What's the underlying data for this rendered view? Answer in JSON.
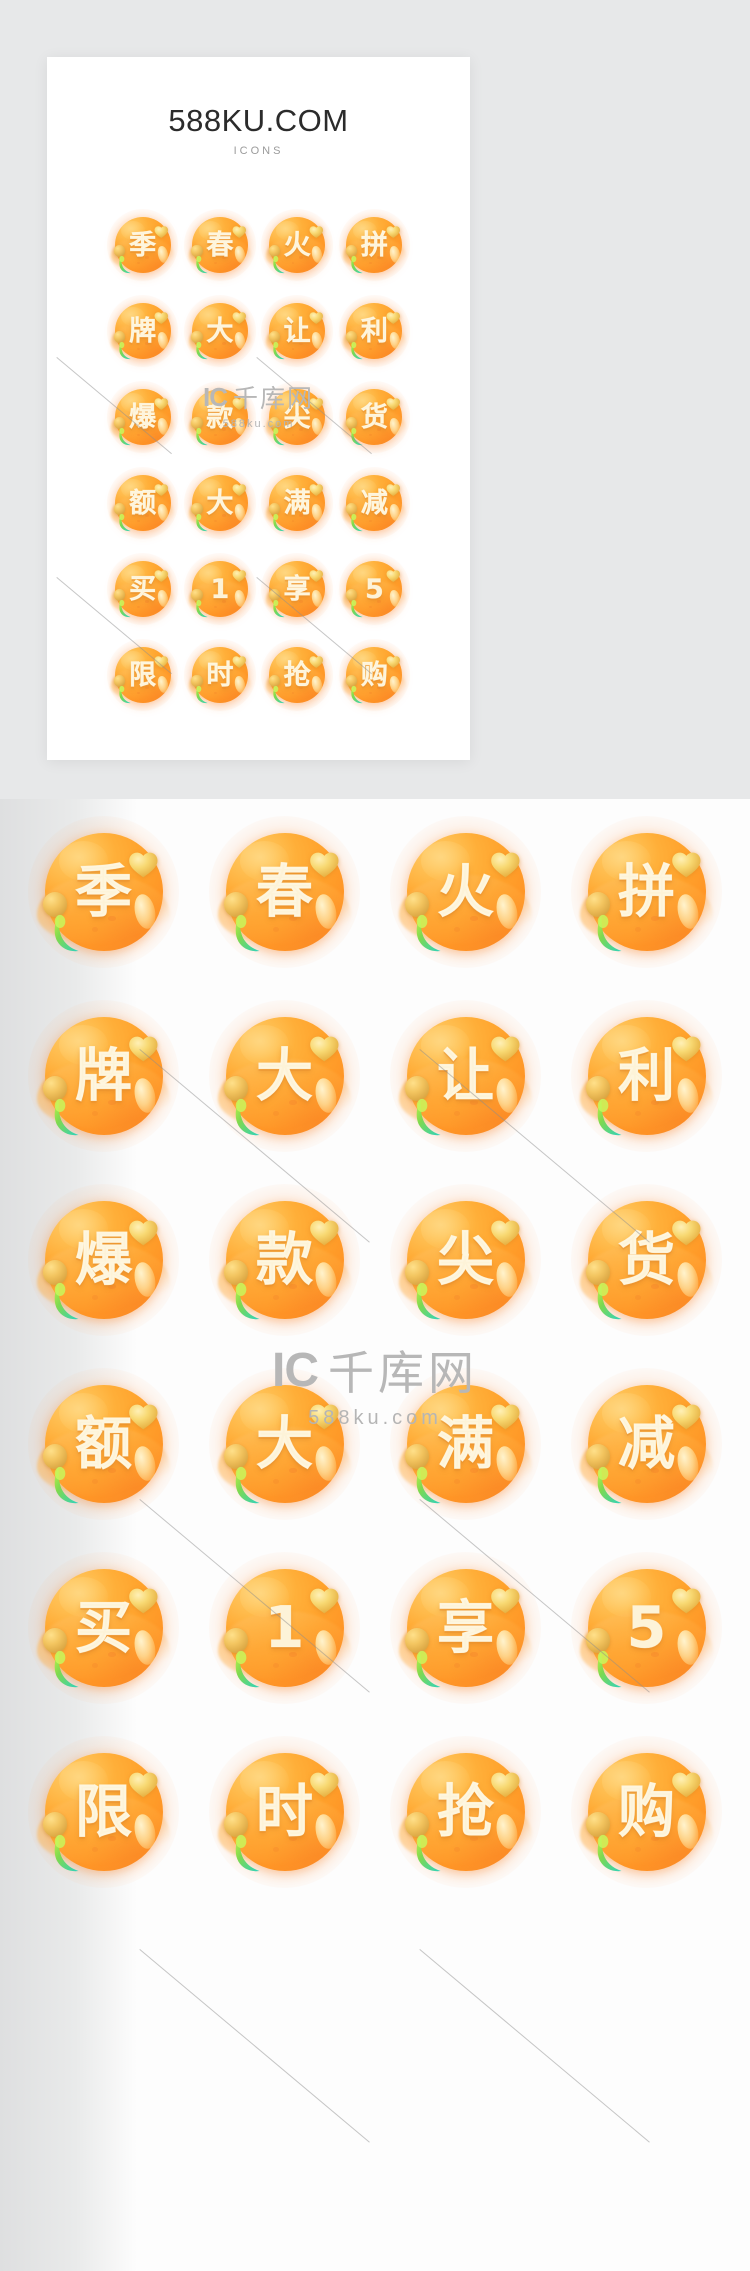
{
  "background_color": "#e7e8e9",
  "preview": {
    "title": "588KU.COM",
    "subtitle": "ICONS"
  },
  "watermark": {
    "logo_mark": "IC",
    "brand_cn": "千库网",
    "url": "588ku.com"
  },
  "colors": {
    "icon_gradient_start": "#ffc04e",
    "icon_gradient_end": "#f98b23",
    "icon_label": "#fdf3d8",
    "heart": "#f6cf63",
    "pebble": "#e0ae47",
    "leaf_green": "#8fd14a",
    "leaf_teal": "#3fd0c0",
    "title": "#2b2b2b",
    "subtitle": "#9b9b9b",
    "watermark": "#b7b7b7",
    "card": "#ffffff"
  },
  "icons": [
    {
      "label": "季",
      "name": "icon-ji"
    },
    {
      "label": "春",
      "name": "icon-chun"
    },
    {
      "label": "火",
      "name": "icon-huo"
    },
    {
      "label": "拼",
      "name": "icon-pin"
    },
    {
      "label": "牌",
      "name": "icon-pai"
    },
    {
      "label": "大",
      "name": "icon-da-1"
    },
    {
      "label": "让",
      "name": "icon-rang"
    },
    {
      "label": "利",
      "name": "icon-li"
    },
    {
      "label": "爆",
      "name": "icon-bao"
    },
    {
      "label": "款",
      "name": "icon-kuan"
    },
    {
      "label": "尖",
      "name": "icon-jian"
    },
    {
      "label": "货",
      "name": "icon-huo-goods"
    },
    {
      "label": "额",
      "name": "icon-e"
    },
    {
      "label": "大",
      "name": "icon-da-2"
    },
    {
      "label": "满",
      "name": "icon-man"
    },
    {
      "label": "减",
      "name": "icon-jian-reduce"
    },
    {
      "label": "买",
      "name": "icon-mai"
    },
    {
      "label": "1",
      "name": "icon-one"
    },
    {
      "label": "享",
      "name": "icon-xiang"
    },
    {
      "label": "5",
      "name": "icon-five"
    },
    {
      "label": "限",
      "name": "icon-xian"
    },
    {
      "label": "时",
      "name": "icon-shi"
    },
    {
      "label": "抢",
      "name": "icon-qiang"
    },
    {
      "label": "购",
      "name": "icon-gou"
    }
  ]
}
